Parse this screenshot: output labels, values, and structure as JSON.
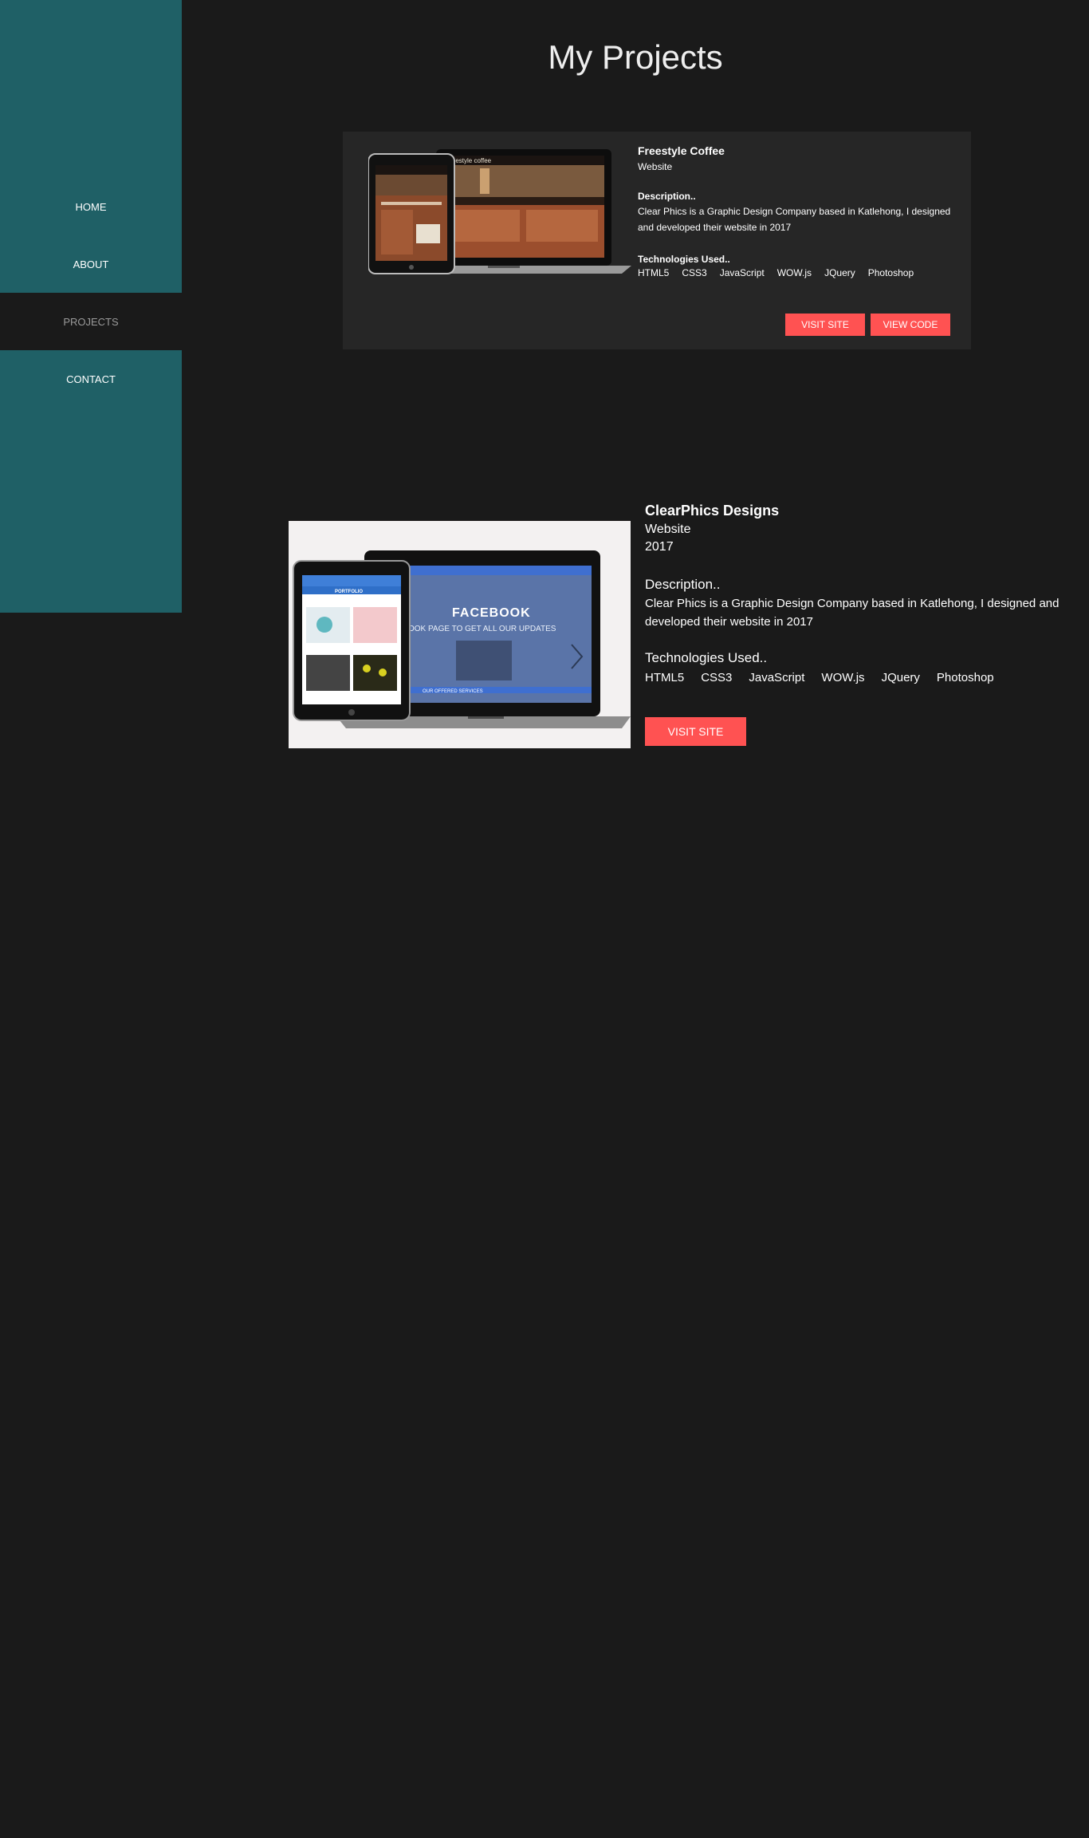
{
  "nav": {
    "items": [
      {
        "label": "HOME"
      },
      {
        "label": "ABOUT"
      },
      {
        "label": "PROJECTS"
      },
      {
        "label": "CONTACT"
      }
    ],
    "active": "PROJECTS"
  },
  "page": {
    "title": "My Projects"
  },
  "projects": [
    {
      "name": "Freestyle Coffee",
      "type": "Website",
      "description_label": "Description..",
      "description": "Clear Phics is a Graphic Design Company based in Katlehong, I designed and developed their website in 2017",
      "technologies_label": "Technologies Used..",
      "technologies": [
        "HTML5",
        "CSS3",
        "JavaScript",
        "WOW.js",
        "JQuery",
        "Photoshop"
      ],
      "visit_label": "VISIT SITE",
      "code_label": "VIEW CODE",
      "screenshot_text": "freestyle coffee"
    },
    {
      "name": "ClearPhics Designs",
      "type": "Website",
      "year": "2017",
      "description_label": "Description..",
      "description": "Clear Phics is a Graphic Design Company based in Katlehong, I designed and developed their website in 2017",
      "technologies_label": "Technologies Used..",
      "technologies": [
        "HTML5",
        "CSS3",
        "JavaScript",
        "WOW.js",
        "JQuery",
        "Photoshop"
      ],
      "visit_label": "VISIT SITE",
      "screenshot_heading": "FACEBOOK",
      "screenshot_sub": "OOK PAGE TO GET ALL OUR UPDATES",
      "screenshot_footer": "OUR OFFERED SERVICES",
      "screenshot_tablet_title": "PORTFOLIO"
    }
  ],
  "colors": {
    "sidebar": "#1f6066",
    "background": "#1a1a1a",
    "card": "#262626",
    "accent": "#ff5252"
  }
}
